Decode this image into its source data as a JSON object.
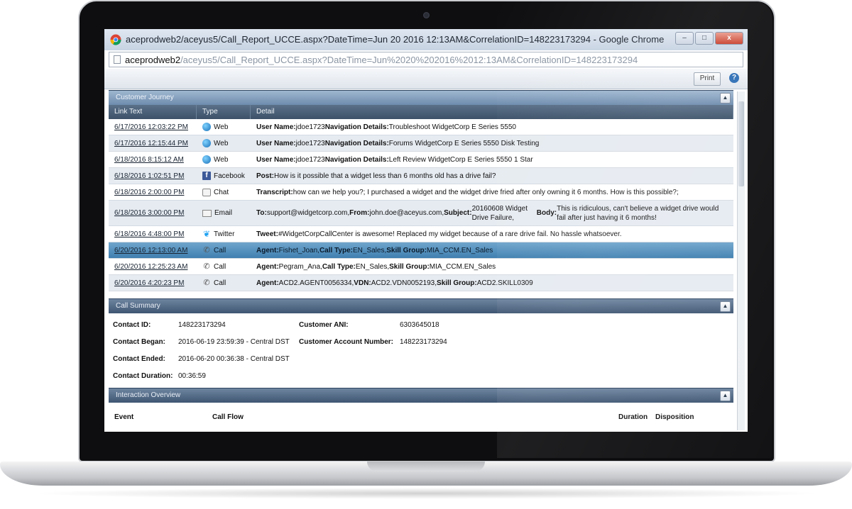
{
  "window": {
    "title": "aceprodweb2/aceyus5/Call_Report_UCCE.aspx?DateTime=Jun 20 2016 12:13AM&CorrelationID=148223173294 - Google Chrome",
    "url_host": "aceprodweb2",
    "url_path": "/aceyus5/Call_Report_UCCE.aspx?DateTime=Jun%2020%202016%2012:13AM&CorrelationID=148223173294",
    "buttons": {
      "minimize": "–",
      "maximize": "□",
      "close": "x"
    }
  },
  "toolbar": {
    "print_label": "Print",
    "help_label": "?"
  },
  "journey": {
    "title": "Customer Journey",
    "columns": [
      "Link Text",
      "Type",
      "Detail"
    ],
    "rows": [
      {
        "link": "6/17/2016 12:03:22 PM",
        "type": "Web",
        "icon": "globe-icon",
        "detail": "<b>User Name:</b> jdoe1723 <b>Navigation Details:</b> Troubleshoot WidgetCorp E Series 5550"
      },
      {
        "link": "6/17/2016 12:15:44 PM",
        "type": "Web",
        "icon": "globe-icon",
        "detail": "<b>User Name:</b> jdoe1723 <b>Navigation Details:</b> Forums WidgetCorp E Series 5550 Disk Testing"
      },
      {
        "link": "6/18/2016 8:15:12 AM",
        "type": "Web",
        "icon": "globe-icon",
        "detail": "<b>User Name:</b> jdoe1723 <b>Navigation Details:</b> Left Review WidgetCorp E Series 5550 1 Star"
      },
      {
        "link": "6/18/2016 1:02:51 PM",
        "type": "Facebook",
        "icon": "facebook-icon",
        "detail": "<b>Post:</b> How is it possible that a widget less than 6 months old has a drive fail?"
      },
      {
        "link": "6/18/2016 2:00:00 PM",
        "type": "Chat",
        "icon": "chat-icon",
        "detail": "<b>Transcript:</b> how can we help you?; I purchased a widget and the widget drive fried after only owning it 6 months. How is this possible?;"
      },
      {
        "link": "6/18/2016 3:00:00 PM",
        "type": "Email",
        "icon": "email-icon",
        "detail": "<b>To:</b> support@widgetcorp.com, <b>From:</b> john.doe@aceyus.com, <b>Subject:</b> 20160608 Widget Drive Failure, <b>Body:</b> This is ridiculous, can't believe a widget drive would fail after just having it 6 months!"
      },
      {
        "link": "6/18/2016 4:48:00 PM",
        "type": "Twitter",
        "icon": "twitter-icon",
        "detail": "<b>Tweet:</b> #WidgetCorpCallCenter is awesome! Replaced my widget because of a rare drive fail. No hassle whatsoever."
      },
      {
        "link": "6/20/2016 12:13:00 AM",
        "type": "Call",
        "icon": "phone-icon",
        "detail": "<b>Agent:</b> Fishet_Joan, <b>Call Type:</b> EN_Sales, <b>Skill Group:</b> MIA_CCM.EN_Sales",
        "selected": true
      },
      {
        "link": "6/20/2016 12:25:23 AM",
        "type": "Call",
        "icon": "phone-icon",
        "detail": "<b>Agent:</b> Pegram_Ana, <b>Call Type:</b> EN_Sales, <b>Skill Group:</b> MIA_CCM.EN_Sales"
      },
      {
        "link": "6/20/2016 4:20:23 PM",
        "type": "Call",
        "icon": "phone-icon",
        "detail": "<b>Agent:</b> ACD2.AGENT0056334, <b>VDN:</b> ACD2.VDN0052193, <b>Skill Group:</b> ACD2.SKILL0309"
      }
    ]
  },
  "summary": {
    "title": "Call Summary",
    "contact_id_label": "Contact ID:",
    "contact_id": "148223173294",
    "ani_label": "Customer ANI:",
    "ani": "6303645018",
    "began_label": "Contact Began:",
    "began": "2016-06-19 23:59:39 - Central DST",
    "account_label": "Customer Account Number:",
    "account": "148223173294",
    "ended_label": "Contact Ended:",
    "ended": "2016-06-20 00:36:38 - Central DST",
    "duration_label": "Contact Duration:",
    "duration": "00:36:59"
  },
  "overview": {
    "title": "Interaction Overview",
    "columns": [
      "Event",
      "Call Flow",
      "Duration",
      "Disposition"
    ]
  },
  "colors": {
    "header_dark": "#3f5672",
    "selected_row": "#3f7fb0",
    "alt_row": "#e6ebf1"
  }
}
